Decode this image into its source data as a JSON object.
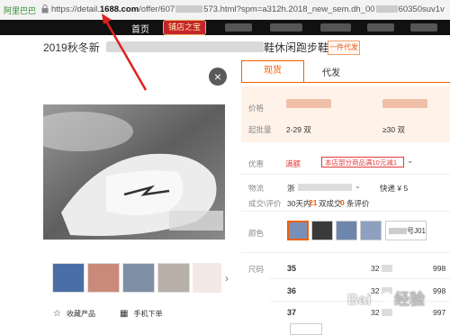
{
  "browser": {
    "site_badge": "阿里巴巴",
    "url_prefix": "https://detail.",
    "url_domain": "1688.com",
    "url_path": "/offer/607",
    "url_rest": "573.html?spm=a312h.2018_new_sem.dh_00",
    "url_tail": "60350suv1v"
  },
  "site_nav": {
    "home": "首页",
    "shop_button": "铺店之宝"
  },
  "product": {
    "title_prefix": "2019秋冬新",
    "title_suffix": "鞋休闲跑步鞋",
    "dropship_tag": "一件代发"
  },
  "gallery": {
    "close_icon": "×",
    "next_icon": "›",
    "favorite_label": "收藏产品",
    "phone_order_label": "手机下单",
    "favorite_icon": "☆",
    "qr_icon": "▦"
  },
  "tabs": {
    "active": "现货",
    "other": "代发"
  },
  "price": {
    "price_label": "价格",
    "min_qty_label": "起批量",
    "tier1_qty": "2-29 双",
    "tier2_qty": "≥30 双"
  },
  "info": {
    "promo_label": "优惠",
    "promo_tag": "满额",
    "promo_text": "本店部分商品满10元减1",
    "logistics_label": "物流",
    "logistics_from": "浙",
    "express_price": "快递 ¥ 5",
    "reviews_label": "成交\\评价",
    "deals_prefix": "30天内",
    "deals_count": "21",
    "deals_suffix": "双成交",
    "reviews_count": "0",
    "reviews_suffix": "条评价",
    "color_label": "颜色",
    "color_last_suffix": "号J01",
    "size_label": "尺码",
    "sizes": [
      {
        "size": "35",
        "price": "32",
        "stock": "998"
      },
      {
        "size": "36",
        "price": "32",
        "stock": "998"
      },
      {
        "size": "37",
        "price": "32",
        "stock": "997"
      }
    ]
  },
  "colors": {
    "accent": "#f06000",
    "promo_red": "#e4393c",
    "nav_bg": "#111111"
  }
}
